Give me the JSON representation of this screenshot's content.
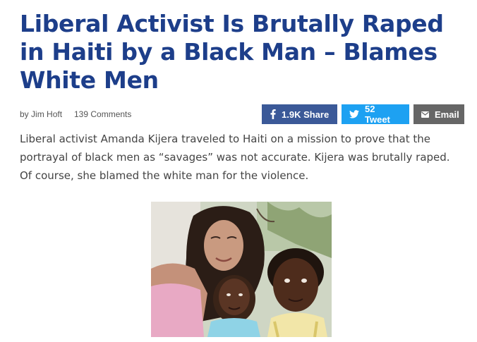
{
  "article": {
    "title": "Liberal Activist Is Brutally Raped in Haiti by a Black Man – Blames White Men",
    "byline_prefix": "by",
    "author": "Jim Hoft",
    "comments": "139 Comments",
    "lede": "Liberal activist Amanda Kijera traveled to Haiti on a mission to prove that the portrayal of black men as “savages” was not accurate. Kijera was brutally raped. Of course, she blamed the white man for the violence."
  },
  "share": {
    "facebook": {
      "label": "1.9K Share",
      "icon": "facebook-icon",
      "color": "#3b5998"
    },
    "twitter": {
      "label": "52 Tweet",
      "icon": "twitter-icon",
      "color": "#1da1f2"
    },
    "email": {
      "label": "Email",
      "icon": "envelope-icon",
      "color": "#666666"
    }
  },
  "colors": {
    "headline": "#1d3e8a",
    "body_text": "#444444"
  }
}
